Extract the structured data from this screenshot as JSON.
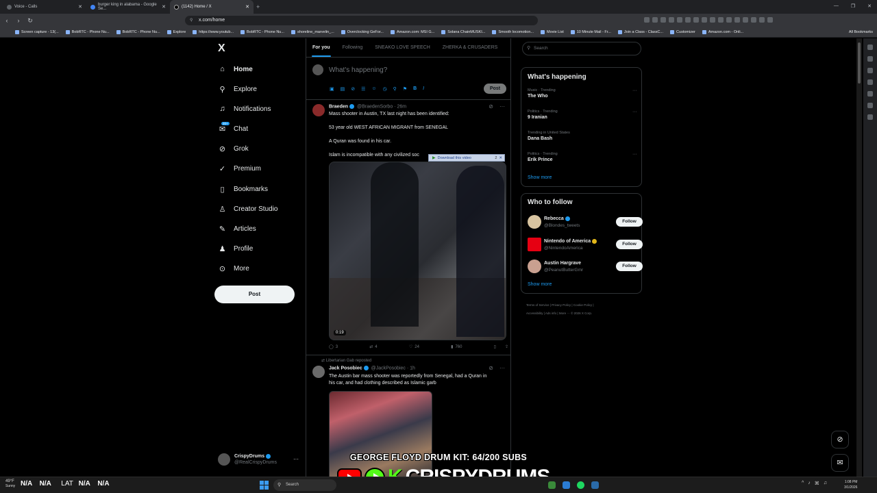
{
  "browser": {
    "tabs": [
      {
        "title": "Voice - Calls",
        "active": false
      },
      {
        "title": "burger king in alabama - Google Se...",
        "active": false
      },
      {
        "title": "(1142) Home / X",
        "active": true
      }
    ],
    "url": "x.com/home",
    "bookmarks": [
      "Screen capture - 13(...",
      "BobRTC - Phone Nu...",
      "BobRTC - Phone Nu...",
      "Explore",
      "https://www.youtub...",
      "BobRTC - Phone Nu...",
      "shoreline_marvelin_...",
      "Overclocking GeFor...",
      "Amazon.com: MSI G...",
      "Solana ChainMUSKI...",
      "Smooth locomotion...",
      "Movie List",
      "10 Minute Mail - Fr...",
      "Join a Class - ClassC...",
      "Customizer",
      "Amazon.com - Onli..."
    ],
    "all_bookmarks": "All Bookmarks"
  },
  "nav": {
    "logo": "X",
    "items": [
      {
        "label": "Home",
        "icon": "home-icon"
      },
      {
        "label": "Explore",
        "icon": "search-icon"
      },
      {
        "label": "Notifications",
        "icon": "bell-icon"
      },
      {
        "label": "Chat",
        "icon": "chat-icon"
      },
      {
        "label": "Grok",
        "icon": "grok-icon"
      },
      {
        "label": "Premium",
        "icon": "premium-icon"
      },
      {
        "label": "Bookmarks",
        "icon": "bookmark-icon"
      },
      {
        "label": "Creator Studio",
        "icon": "creator-icon"
      },
      {
        "label": "Articles",
        "icon": "articles-icon"
      },
      {
        "label": "Profile",
        "icon": "profile-icon"
      },
      {
        "label": "More",
        "icon": "more-icon"
      }
    ],
    "chat_badge": "20+",
    "post_label": "Post",
    "account": {
      "name": "CrispyDrums",
      "handle": "@RealCrispyDrums"
    }
  },
  "timeline": {
    "tabs": [
      "For you",
      "Following",
      "SNEAKO LOVE SPEECH",
      "ZHERKA & CRUSADERS"
    ],
    "composer_placeholder": "What's happening?",
    "composer_post": "Post",
    "tweets": [
      {
        "name": "Braeden",
        "handle": "@BraedenSorbo",
        "time": "· 26m",
        "lines": [
          "Mass shooter in Austin, TX last night has been identified:",
          "53 year old WEST AFRICAN MIGRANT from SENEGAL",
          "A Quran was found in his car.",
          "Islam is incompatible with any civilized soc"
        ],
        "video_duration": "0:19",
        "replies": "3",
        "reposts": "4",
        "likes": "24",
        "views": "760"
      },
      {
        "repost_by": "Libertarian Gab reposted",
        "name": "Jack Posobiec",
        "handle": "@JackPosobiec",
        "time": "· 1h",
        "lines": [
          "The Austin bar mass shooter was reportedly from Senegal, had a Quran in",
          "his car, and had clothing described as Islamic garb"
        ]
      }
    ],
    "download_overlay": {
      "label": "Download this video",
      "count": "2"
    }
  },
  "sidebar": {
    "search_placeholder": "Search",
    "happening_title": "What's happening",
    "trends": [
      {
        "category": "Music · Trending",
        "name": "The Who"
      },
      {
        "category": "Politics · Trending",
        "name": "9 Iranian"
      },
      {
        "category": "Trending in United States",
        "name": "Dana Bash"
      },
      {
        "category": "Politics · Trending",
        "name": "Erik Prince"
      }
    ],
    "show_more": "Show more",
    "follow_title": "Who to follow",
    "follow": [
      {
        "name": "Rebecca",
        "handle": "@Blondes_tweets",
        "badge": "blue"
      },
      {
        "name": "Nintendo of America",
        "handle": "@NintendoAmerica",
        "badge": "gold"
      },
      {
        "name": "Austin Hargrave",
        "handle": "@PeanutButterGmr",
        "badge": "none"
      }
    ],
    "follow_label": "Follow",
    "footer_line1": "Terms of Service  |  Privacy Policy  |  Cookie Policy  |",
    "footer_line2": "Accessibility  |  Ads info  |  More ···  © 2026 X Corp."
  },
  "overlay": {
    "banner_text": "GEORGE FLOYD DRUM KIT: 64/200 SUBS",
    "brand": "CRISPYDRUMS",
    "kick_letter": "K"
  },
  "taskbar": {
    "weather_temp": "49°F",
    "weather_desc": "Sunny",
    "stat1": "N/A",
    "stat2": "N/A",
    "lat_label": "LAT",
    "stat3": "N/A",
    "stat4": "N/A",
    "search": "Search",
    "time": "1:08 PM",
    "date": "3/1/2026"
  },
  "colors": {
    "accent": "#1d9bf0",
    "background": "#000000",
    "kick_green": "#53fc18",
    "youtube_red": "#ff0000"
  }
}
